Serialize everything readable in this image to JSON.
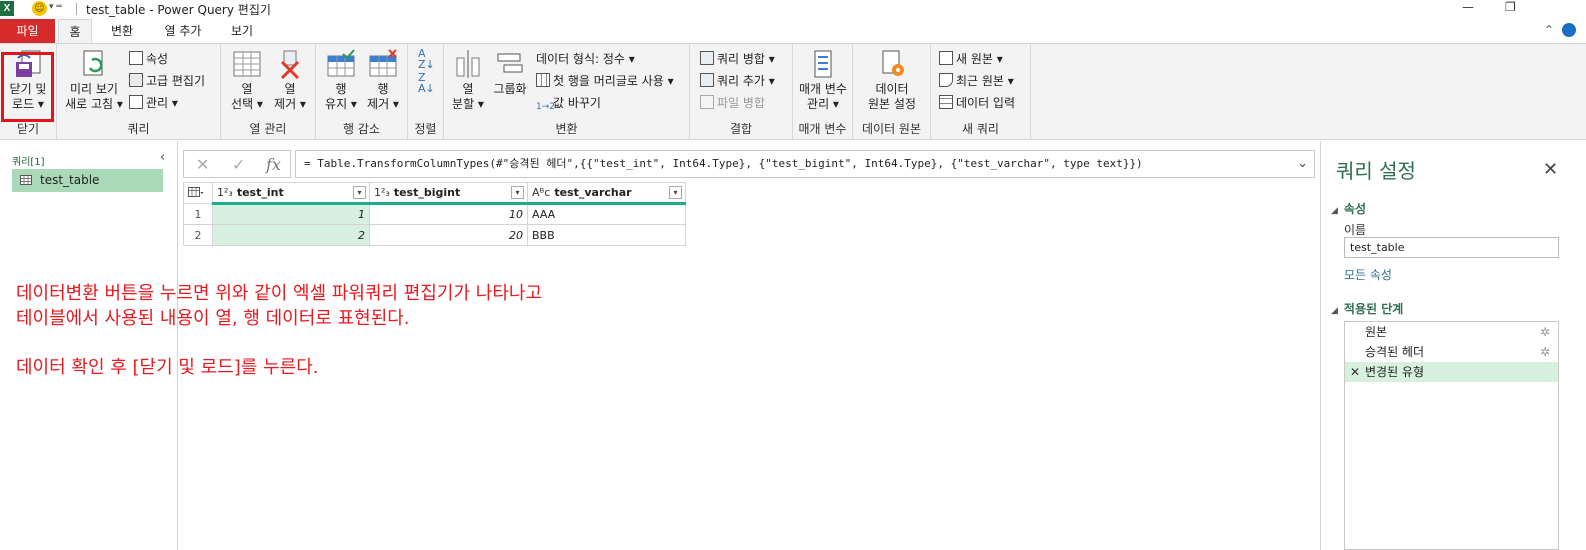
{
  "titlebar": {
    "app_icon": "X",
    "title": "test_table - Power Query 편집기",
    "restore": "❐",
    "minimize": "—"
  },
  "tabs": [
    {
      "label": "파일"
    },
    {
      "label": "홈"
    },
    {
      "label": "변환"
    },
    {
      "label": "열 추가"
    },
    {
      "label": "보기"
    }
  ],
  "ribbon": {
    "close_load": {
      "line1": "닫기 및",
      "line2": "로드 ▾",
      "group": "닫기"
    },
    "query": {
      "preview_refresh_1": "미리 보기",
      "preview_refresh_2": "새로 고침 ▾",
      "properties": "속성",
      "advanced_editor": "고급 편집기",
      "manage": "관리 ▾",
      "group": "쿼리"
    },
    "columns": {
      "choose_1": "열",
      "choose_2": "선택 ▾",
      "remove_1": "열",
      "remove_2": "제거 ▾",
      "group": "열 관리"
    },
    "rows": {
      "keep_1": "행",
      "keep_2": "유지 ▾",
      "remove_1": "행",
      "remove_2": "제거 ▾",
      "group": "행 감소"
    },
    "sort": {
      "group": "정렬"
    },
    "transform": {
      "split_1": "열",
      "split_2": "분할 ▾",
      "group_by": "그룹화",
      "data_type": "데이터 형식: 정수 ▾",
      "first_row_header": "첫 행을 머리글로 사용 ▾",
      "replace_values": "값 바꾸기",
      "group": "변환"
    },
    "combine": {
      "merge": "쿼리 병합 ▾",
      "append": "쿼리 추가 ▾",
      "combine_files": "파일 병합",
      "group": "결합"
    },
    "params": {
      "line1": "매개 변수",
      "line2": "관리 ▾",
      "group": "매개 변수"
    },
    "datasource": {
      "line1": "데이터",
      "line2": "원본 설정",
      "group": "데이터 원본"
    },
    "newquery": {
      "new_source": "새 원본 ▾",
      "recent_source": "최근 원본 ▾",
      "enter_data": "데이터 입력",
      "group": "새 쿼리"
    }
  },
  "leftpane": {
    "header": "쿼리[1]",
    "collapse": "‹",
    "items": [
      {
        "label": "test_table"
      }
    ]
  },
  "formula": {
    "cancel": "✕",
    "commit": "✓",
    "fx": "fx",
    "text": "= Table.TransformColumnTypes(#\"승격된 헤더\",{{\"test_int\", Int64.Type}, {\"test_bigint\", Int64.Type}, {\"test_varchar\", type text}})",
    "expand": "⌄"
  },
  "table": {
    "columns": [
      {
        "type": "1²₃",
        "name": "test_int"
      },
      {
        "type": "1²₃",
        "name": "test_bigint"
      },
      {
        "type": "Aᴮc",
        "name": "test_varchar"
      }
    ],
    "rows": [
      {
        "n": "1",
        "test_int": "1",
        "test_bigint": "10",
        "test_varchar": "AAA"
      },
      {
        "n": "2",
        "test_int": "2",
        "test_bigint": "20",
        "test_varchar": "BBB"
      }
    ]
  },
  "annotation": {
    "line1": "데이터변환 버튼을 누르면 위와 같이 엑셀 파워쿼리 편집기가 나타나고",
    "line2": "테이블에서 사용된 내용이 열, 행 데이터로 표현된다.",
    "line3": "데이터 확인 후 [닫기 및 로드]를 누른다."
  },
  "settings": {
    "title": "쿼리 설정",
    "close": "✕",
    "properties_label": "속성",
    "name_label": "이름",
    "name_value": "test_table",
    "all_properties": "모든 속성",
    "applied_steps_label": "적용된 단계",
    "steps": [
      {
        "label": "원본"
      },
      {
        "label": "승격된 헤더"
      },
      {
        "label": "변경된 유형"
      }
    ]
  }
}
